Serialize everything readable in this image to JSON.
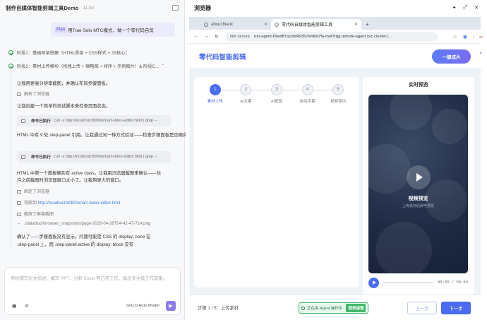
{
  "left": {
    "title": "制作自媒体智能剪辑工具Demo",
    "time": "11:34",
    "plan_tag": "Plan",
    "plan_text": "用Trae Solo MTC模式，做一个零代码自剪",
    "steps": [
      {
        "label": "阶段1：基础框架搭建（HTML骨架 + CSS样式 + JS核心）"
      },
      {
        "label": "阶段2：素材上传模块（拖拽上传 + 缩略图 + 排序 + 示例图片）& 阶段C..."
      }
    ],
    "messages": {
      "m1": "让我用更高分辨率截图，并确认布局步骤面板。",
      "m2": "解析了浏览器",
      "m3": "让我创建一个简单的测试脚本来检查页面状态。",
      "cmd1_label": "命令已执行",
      "cmd1_text": "curl -s http://localhost:8080/smart-video-editor.html | grep --",
      "m4": "HTML 中有 9 处 step-panel 引用。让我通过另一种方式验证——检查步骤面板是否确实被渲染了。",
      "cmd2_label": "命令已执行",
      "cmd2_text": "curl -s http://localhost:8080/smart-video-editor.html | grep --",
      "m5a": "HTML 中第一个面板确实有 active class。让我用浏览器截图来确认——也",
      "m5b": "许之前截图时浏览器窗口太小了。让我用更大的窗口。",
      "m6": "固定了浏览器",
      "m7_label": "导航到",
      "m7_link": "http://localhost:8080/smart-video-editor.html",
      "m8": "截取了屏幕截图",
      "m9": "./data/tool/browser_snapshots/page-2026-04-26T04-42-47-714.png",
      "m10": "确认了——步骤面板没有显示。问题可能是 CSS 的 display: none 在",
      "m11": ".step-panel 上，而 .step-panel.active 的 display: block 没有"
    },
    "input_placeholder": "帮你撰写论文综述、编写 PPT、分析 Excel 等日常工作，输出专业级工作成果。",
    "model": "SOLO Auto Model"
  },
  "right": {
    "title": "浏览器",
    "tabs": [
      {
        "label": "about:blank"
      },
      {
        "label": "零代码自媒体智能剪辑工具"
      }
    ],
    "not_secure": "Not secure",
    "url": "run-agent-69ed87a1dbf49357efd0d7fa-mof7rtgj.remote-agent.svc.cluster.l...",
    "app_title": "零代码智能剪辑",
    "generate_btn": "一键成片",
    "stepper": [
      {
        "num": "1",
        "label": "素材上传"
      },
      {
        "num": "2",
        "label": "AI文案"
      },
      {
        "num": "3",
        "label": "AI配音"
      },
      {
        "num": "4",
        "label": "自动字幕"
      },
      {
        "num": "5",
        "label": "视频导出"
      }
    ],
    "preview_title": "实时预览",
    "video_title": "视频预览",
    "video_sub": "上传素材后即可预览",
    "time_display": "00:00 / 00:00",
    "footer_info": "步骤 1 / 5：上传素材",
    "agent_text": "正在由 Agent 操作中",
    "agent_take": "我来接管",
    "prev_btn": "上一步",
    "next_btn": "下一步"
  }
}
